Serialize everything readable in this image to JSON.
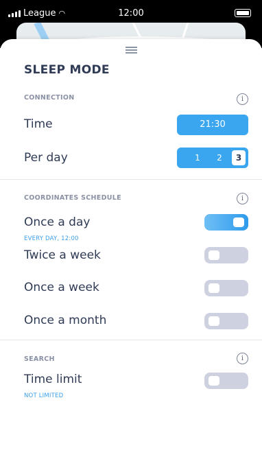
{
  "status_bar": {
    "carrier": "League",
    "time": "12:00"
  },
  "sheet": {
    "title": "SLEEP MODE",
    "connection": {
      "header": "CONNECTION",
      "time_label": "Time",
      "time_value": "21:30",
      "per_day_label": "Per day",
      "per_day_options": [
        "1",
        "2",
        "3"
      ],
      "per_day_selected": "3"
    },
    "coordinates": {
      "header": "COORDINATES SCHEDULE",
      "items": [
        {
          "label": "Once a day",
          "sub": "EVERY DAY, 12:00",
          "enabled": true
        },
        {
          "label": "Twice a week",
          "sub": "",
          "enabled": false
        },
        {
          "label": "Once a week",
          "sub": "",
          "enabled": false
        },
        {
          "label": "Once a month",
          "sub": "",
          "enabled": false
        }
      ]
    },
    "search": {
      "header": "SEARCH",
      "time_limit_label": "Time limit",
      "time_limit_sub": "NOT LIMITED",
      "time_limit_enabled": false
    },
    "info_glyph": "i"
  },
  "colors": {
    "accent": "#3aa6ef",
    "toggle_off": "#ced1e0",
    "text": "#2f3a55",
    "muted": "#8a91a4"
  }
}
